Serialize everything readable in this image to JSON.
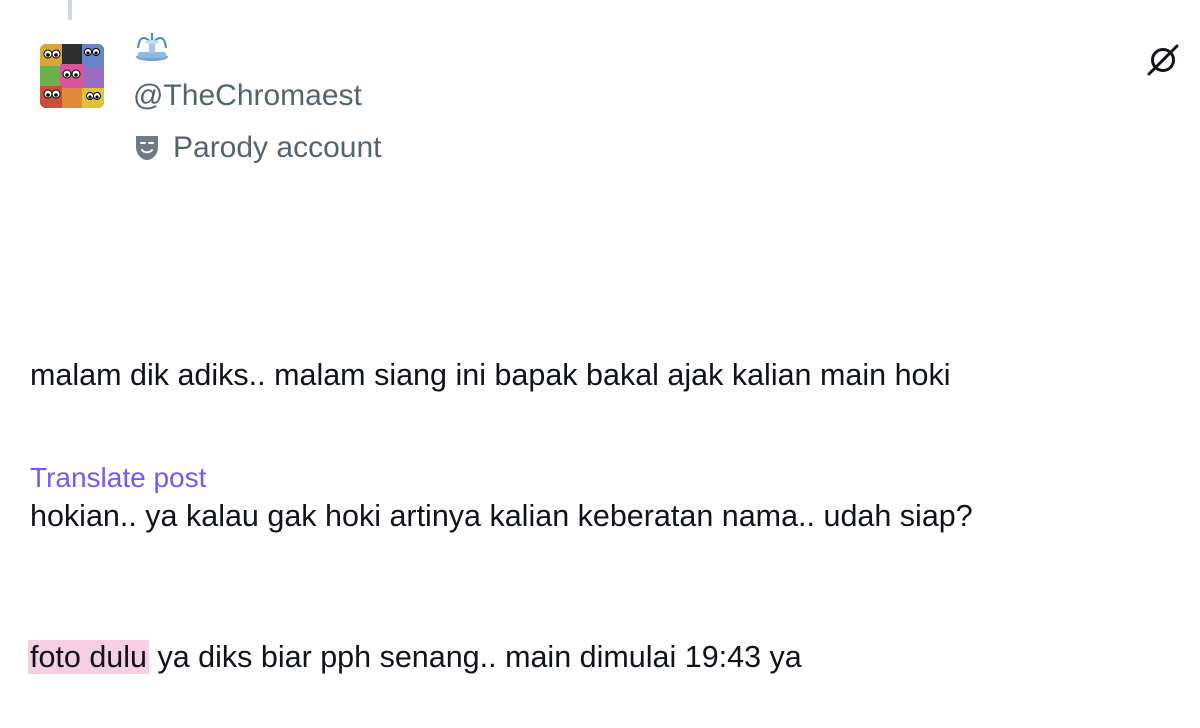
{
  "post": {
    "handle": "@TheChromaest",
    "badge_label": "Parody account",
    "body_lines": [
      "malam dik adiks.. malam siang ini bapak bakal ajak kalian main hoki",
      "hokian.. ya kalau gak hoki artinya kalian keberatan nama.. udah siap?"
    ],
    "highlighted_text": "foto dulu",
    "body_line3_rest": " ya diks biar pph senang.. main dimulai 19:43 ya",
    "translate_label": "Translate post"
  },
  "icons": {
    "avatar": "avatar-image",
    "display_name_emoji": "fountain-emoji-icon",
    "parody_badge": "theater-mask-icon",
    "more": "grok-icon"
  },
  "colors": {
    "text_primary": "#0f1419",
    "text_secondary": "#536471",
    "link": "#7856ff",
    "highlight": "#f6cfe3"
  }
}
